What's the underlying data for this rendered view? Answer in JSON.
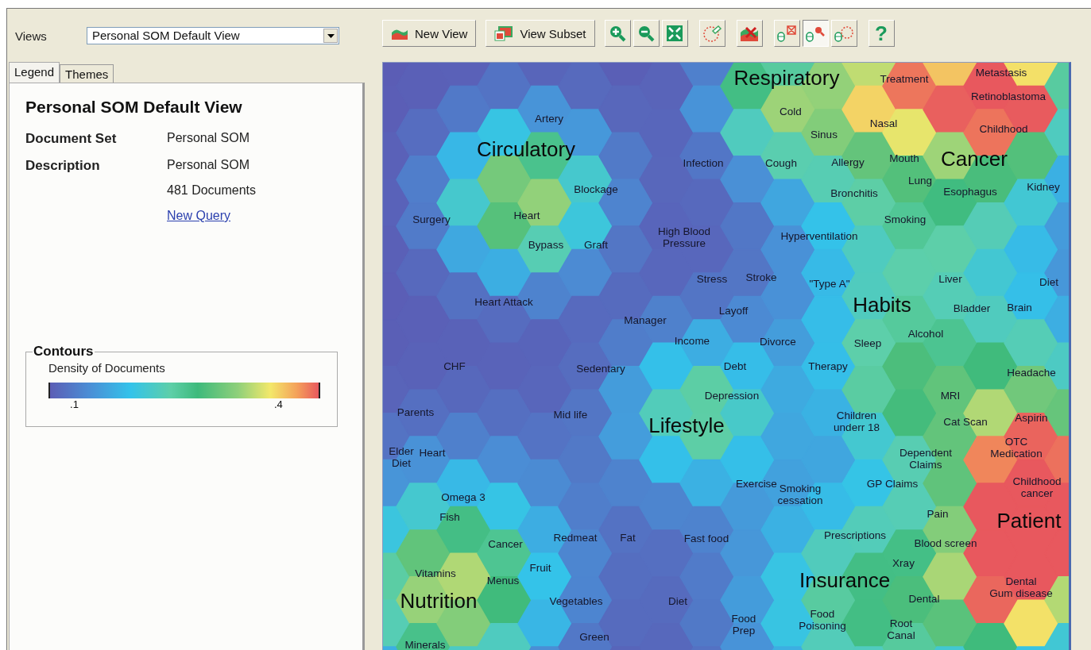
{
  "views": {
    "label": "Views",
    "value": "Personal SOM Default View"
  },
  "tabs": [
    {
      "label": "Legend",
      "selected": true
    },
    {
      "label": "Themes",
      "selected": false
    }
  ],
  "legend": {
    "title": "Personal SOM Default View",
    "fields": [
      {
        "label": "Document Set",
        "values": [
          "Personal SOM"
        ]
      },
      {
        "label": "Description",
        "values": [
          "Personal SOM",
          "481 Documents"
        ]
      }
    ],
    "link": "New Query",
    "contours": {
      "title": "Contours",
      "caption": "Density of Documents",
      "ticks": [
        ".1",
        ".4"
      ]
    }
  },
  "toolbar": {
    "buttons": [
      {
        "kind": "new-view",
        "label": "New View"
      },
      {
        "kind": "view-subset",
        "label": "View Subset"
      }
    ],
    "tools": [
      {
        "kind": "zoom-in"
      },
      {
        "kind": "zoom-out"
      },
      {
        "kind": "fit"
      },
      {
        "kind": "lasso"
      },
      {
        "kind": "delete"
      },
      {
        "kind": "mode-expand",
        "selected": false
      },
      {
        "kind": "mode-zoom",
        "selected": true
      },
      {
        "kind": "mode-select",
        "selected": false
      },
      {
        "kind": "help",
        "label": "?"
      }
    ]
  },
  "map": {
    "labels": [
      {
        "text": "Respiratory",
        "kind": "theme"
      },
      {
        "text": "Treatment",
        "kind": "term"
      },
      {
        "text": "Metastasis",
        "kind": "term"
      },
      {
        "text": "Retinoblastoma",
        "kind": "term"
      },
      {
        "text": "Cold",
        "kind": "term"
      },
      {
        "text": "Nasal",
        "kind": "term"
      },
      {
        "text": "Childhood",
        "kind": "term"
      },
      {
        "text": "Sinus",
        "kind": "term"
      },
      {
        "text": "Artery",
        "kind": "term"
      },
      {
        "text": "Circulatory",
        "kind": "theme"
      },
      {
        "text": "Infection",
        "kind": "term"
      },
      {
        "text": "Cough",
        "kind": "term"
      },
      {
        "text": "Allergy",
        "kind": "term"
      },
      {
        "text": "Mouth",
        "kind": "term"
      },
      {
        "text": "Cancer",
        "kind": "theme"
      },
      {
        "text": "Lung",
        "kind": "term"
      },
      {
        "text": "Blockage",
        "kind": "term"
      },
      {
        "text": "Bronchitis",
        "kind": "term"
      },
      {
        "text": "Esophagus",
        "kind": "term"
      },
      {
        "text": "Kidney",
        "kind": "term"
      },
      {
        "text": "Surgery",
        "kind": "term"
      },
      {
        "text": "Heart",
        "kind": "term"
      },
      {
        "text": "Smoking",
        "kind": "term"
      },
      {
        "text": "Bypass",
        "kind": "term"
      },
      {
        "text": "Graft",
        "kind": "term"
      },
      {
        "text": "High Blood\nPressure",
        "kind": "term"
      },
      {
        "text": "Hyperventilation",
        "kind": "term"
      },
      {
        "text": "Stress",
        "kind": "term"
      },
      {
        "text": "Stroke",
        "kind": "term"
      },
      {
        "text": "\"Type A\"",
        "kind": "term"
      },
      {
        "text": "Liver",
        "kind": "term"
      },
      {
        "text": "Diet",
        "kind": "term"
      },
      {
        "text": "Heart Attack",
        "kind": "term"
      },
      {
        "text": "Layoff",
        "kind": "term"
      },
      {
        "text": "Habits",
        "kind": "theme"
      },
      {
        "text": "Bladder",
        "kind": "term"
      },
      {
        "text": "Brain",
        "kind": "term"
      },
      {
        "text": "Manager",
        "kind": "term"
      },
      {
        "text": "Income",
        "kind": "term"
      },
      {
        "text": "Divorce",
        "kind": "term"
      },
      {
        "text": "Sleep",
        "kind": "term"
      },
      {
        "text": "Alcohol",
        "kind": "term"
      },
      {
        "text": "CHF",
        "kind": "term"
      },
      {
        "text": "Sedentary",
        "kind": "term"
      },
      {
        "text": "Debt",
        "kind": "term"
      },
      {
        "text": "Therapy",
        "kind": "term"
      },
      {
        "text": "Headache",
        "kind": "term"
      },
      {
        "text": "Depression",
        "kind": "term"
      },
      {
        "text": "MRI",
        "kind": "term"
      },
      {
        "text": "Parents",
        "kind": "term"
      },
      {
        "text": "Mid life",
        "kind": "term"
      },
      {
        "text": "Lifestyle",
        "kind": "theme"
      },
      {
        "text": "Children\nunderr 18",
        "kind": "term"
      },
      {
        "text": "Cat Scan",
        "kind": "term"
      },
      {
        "text": "Aspirin",
        "kind": "term"
      },
      {
        "text": "Elder\nDiet",
        "kind": "term"
      },
      {
        "text": "Heart",
        "kind": "term"
      },
      {
        "text": "Dependent\nClaims",
        "kind": "term"
      },
      {
        "text": "OTC\nMedication",
        "kind": "term"
      },
      {
        "text": "Exercise",
        "kind": "term"
      },
      {
        "text": "Smoking\ncessation",
        "kind": "term"
      },
      {
        "text": "GP Claims",
        "kind": "term"
      },
      {
        "text": "Childhood\ncancer",
        "kind": "term"
      },
      {
        "text": "Omega 3",
        "kind": "term"
      },
      {
        "text": "Fish",
        "kind": "term"
      },
      {
        "text": "Pain",
        "kind": "term"
      },
      {
        "text": "Patient",
        "kind": "theme"
      },
      {
        "text": "Cancer",
        "kind": "term"
      },
      {
        "text": "Redmeat",
        "kind": "term"
      },
      {
        "text": "Fat",
        "kind": "term"
      },
      {
        "text": "Fast food",
        "kind": "term"
      },
      {
        "text": "Prescriptions",
        "kind": "term"
      },
      {
        "text": "Blood screen",
        "kind": "term"
      },
      {
        "text": "Vitamins",
        "kind": "term"
      },
      {
        "text": "Fruit",
        "kind": "term"
      },
      {
        "text": "Xray",
        "kind": "term"
      },
      {
        "text": "Menus",
        "kind": "term"
      },
      {
        "text": "Insurance",
        "kind": "theme"
      },
      {
        "text": "Nutrition",
        "kind": "theme"
      },
      {
        "text": "Vegetables",
        "kind": "term"
      },
      {
        "text": "Diet",
        "kind": "term"
      },
      {
        "text": "Dental",
        "kind": "term"
      },
      {
        "text": "Dental\nGum disease",
        "kind": "term"
      },
      {
        "text": "Minerals",
        "kind": "term"
      },
      {
        "text": "Green",
        "kind": "term"
      },
      {
        "text": "Food\nPrep",
        "kind": "term"
      },
      {
        "text": "Food\nPoisoning",
        "kind": "term"
      },
      {
        "text": "Root\nCanal",
        "kind": "term"
      }
    ]
  }
}
